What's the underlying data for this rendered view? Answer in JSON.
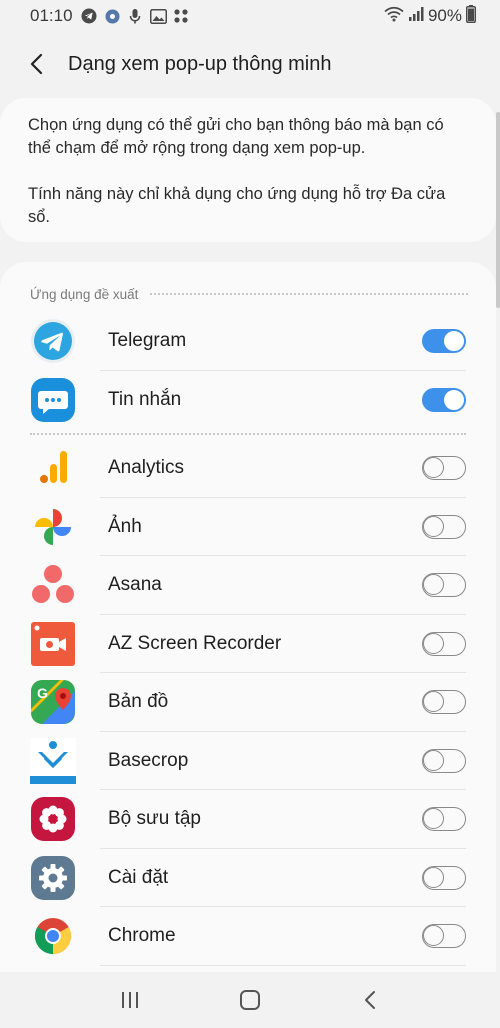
{
  "status_bar": {
    "time": "01:10",
    "battery": "90%",
    "icons": [
      "telegram-notif-icon",
      "settings-notif-icon",
      "mic-notif-icon",
      "image-notif-icon",
      "dots-notif-icon"
    ]
  },
  "header": {
    "title": "Dạng xem pop-up thông minh"
  },
  "description": {
    "para1": "Chọn ứng dụng có thể gửi cho bạn thông báo mà bạn có thể chạm để mở rộng trong dạng xem pop-up.",
    "para2": "Tính năng này chỉ khả dụng cho ứng dụng hỗ trợ Đa cửa sổ."
  },
  "section": {
    "title": "Ứng dụng đề xuất"
  },
  "apps": [
    {
      "name": "Telegram",
      "on": true
    },
    {
      "name": "Tin nhắn",
      "on": true
    },
    {
      "name": "Analytics",
      "on": false
    },
    {
      "name": "Ảnh",
      "on": false
    },
    {
      "name": "Asana",
      "on": false
    },
    {
      "name": "AZ Screen Recorder",
      "on": false
    },
    {
      "name": "Bản đồ",
      "on": false
    },
    {
      "name": "Basecrop",
      "on": false
    },
    {
      "name": "Bộ sưu tập",
      "on": false
    },
    {
      "name": "Cài đặt",
      "on": false
    },
    {
      "name": "Chrome",
      "on": false
    },
    {
      "name": "",
      "on": false
    }
  ],
  "colors": {
    "toggle_on": "#3e91ea",
    "background": "#f2f2f2",
    "card": "#fafafa"
  }
}
